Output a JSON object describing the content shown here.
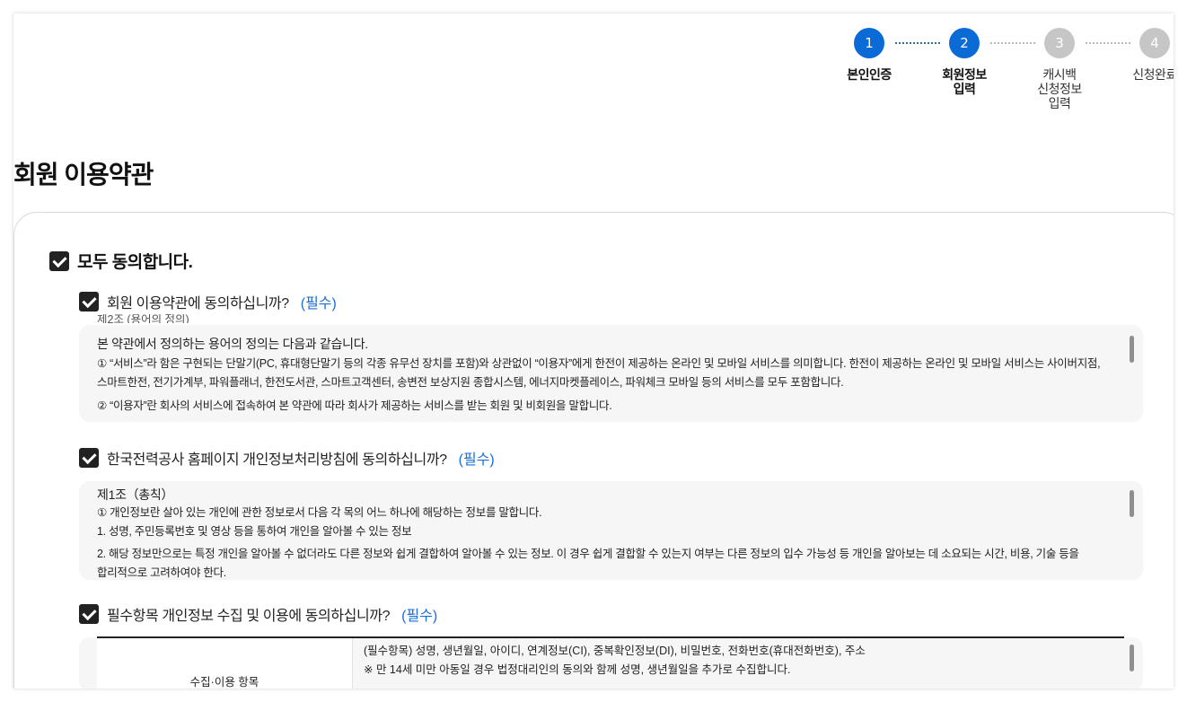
{
  "stepper": {
    "steps": [
      {
        "num": "1",
        "label": "본인인증"
      },
      {
        "num": "2",
        "label": "회원정보\n입력"
      },
      {
        "num": "3",
        "label": "캐시백\n신청정보\n입력"
      },
      {
        "num": "4",
        "label": "신청완료"
      }
    ],
    "active_color": "#0a6ad6",
    "inactive_color": "#c6c6c6"
  },
  "page": {
    "title": "회원 이용약관"
  },
  "agree_all": {
    "label": "모두 동의합니다."
  },
  "terms": [
    {
      "label": "회원 이용약관에 동의하십니까?",
      "required": "(필수)",
      "clipped_top": "제2조 (용어의 정의)",
      "lines": [
        "본 약관에서 정의하는 용어의 정의는 다음과 같습니다.",
        "① “서비스”라 함은 구현되는 단말기(PC, 휴대형단말기 등의 각종 유무선 장치를 포함)와 상관없이 “이용자”에게 한전이 제공하는 온라인 및 모바일 서비스를 의미합니다. 한전이 제공하는 온라인 및 모바일 서비스는 사이버지점,",
        "스마트한전, 전기가계부, 파워플래너, 한전도서관, 스마트고객센터, 송변전 보상지원 종합시스템, 에너지마켓플레이스, 파워체크 모바일 등의 서비스를 모두 포함합니다.",
        "② “이용자”란 회사의 서비스에 접속하여 본 약관에 따라 회사가 제공하는 서비스를 받는 회원 및 비회원을 말합니다."
      ]
    },
    {
      "label": "한국전력공사 홈페이지 개인정보처리방침에 동의하십니까?",
      "required": "(필수)",
      "lines": [
        "제1조（총칙）",
        "① 개인정보란 살아 있는 개인에 관한 정보로서 다음 각 목의 어느 하나에 해당하는 정보를 말합니다.",
        "1. 성명, 주민등록번호 및 영상 등을 통하여 개인을 알아볼 수 있는 정보",
        "2. 해당 정보만으로는 특정 개인을 알아볼 수 없더라도 다른 정보와 쉽게 결합하여 알아볼 수 있는 정보. 이 경우 쉽게 결합할 수 있는지 여부는 다른 정보의 입수 가능성 등 개인을 알아보는 데 소요되는 시간, 비용, 기술 등을",
        "합리적으로 고려하여야 한다."
      ]
    },
    {
      "label": "필수항목 개인정보 수집 및 이용에 동의하십니까?",
      "required": "(필수)",
      "table": {
        "header": "수집·이용 항목",
        "body": [
          "(필수항목) 성명, 생년월일, 아이디, 연계정보(CI), 중복확인정보(DI), 비밀번호, 전화번호(휴대전화번호), 주소",
          "※ 만 14세 미만 아동일 경우 법정대리인의 동의와 함께 성명, 생년월일을 추가로 수집합니다."
        ]
      }
    }
  ]
}
